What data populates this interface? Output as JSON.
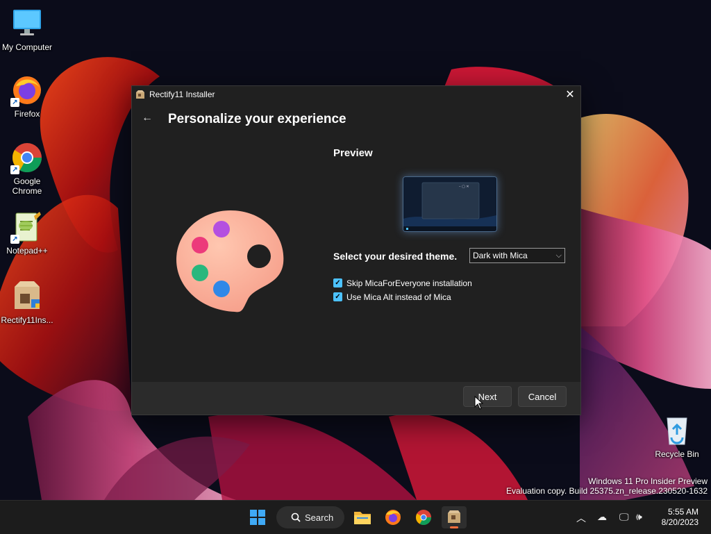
{
  "desktop": {
    "icons": [
      {
        "label": "My Computer"
      },
      {
        "label": "Firefox"
      },
      {
        "label": "Google Chrome"
      },
      {
        "label": "Notepad++"
      },
      {
        "label": "Rectify11Ins..."
      }
    ],
    "recycle_bin": {
      "label": "Recycle Bin"
    }
  },
  "installer": {
    "window_title": "Rectify11 Installer",
    "page_title": "Personalize your experience",
    "preview_label": "Preview",
    "theme_label": "Select your desired theme.",
    "theme_selected": "Dark with Mica",
    "checkboxes": [
      {
        "label": "Skip MicaForEveryone installation",
        "checked": true
      },
      {
        "label": "Use Mica Alt instead of Mica",
        "checked": true
      }
    ],
    "next_label": "Next",
    "cancel_label": "Cancel"
  },
  "watermark": {
    "line1": "Windows 11 Pro Insider Preview",
    "line2": "Evaluation copy. Build 25375.zn_release.230520-1632"
  },
  "taskbar": {
    "search_label": "Search",
    "time": "5:55 AM",
    "date": "8/20/2023"
  },
  "colors": {
    "accent": "#4cc2ff",
    "window_bg": "#202020",
    "footer_bg": "#2b2b2b",
    "taskbar_bg": "#1c1c1c"
  }
}
